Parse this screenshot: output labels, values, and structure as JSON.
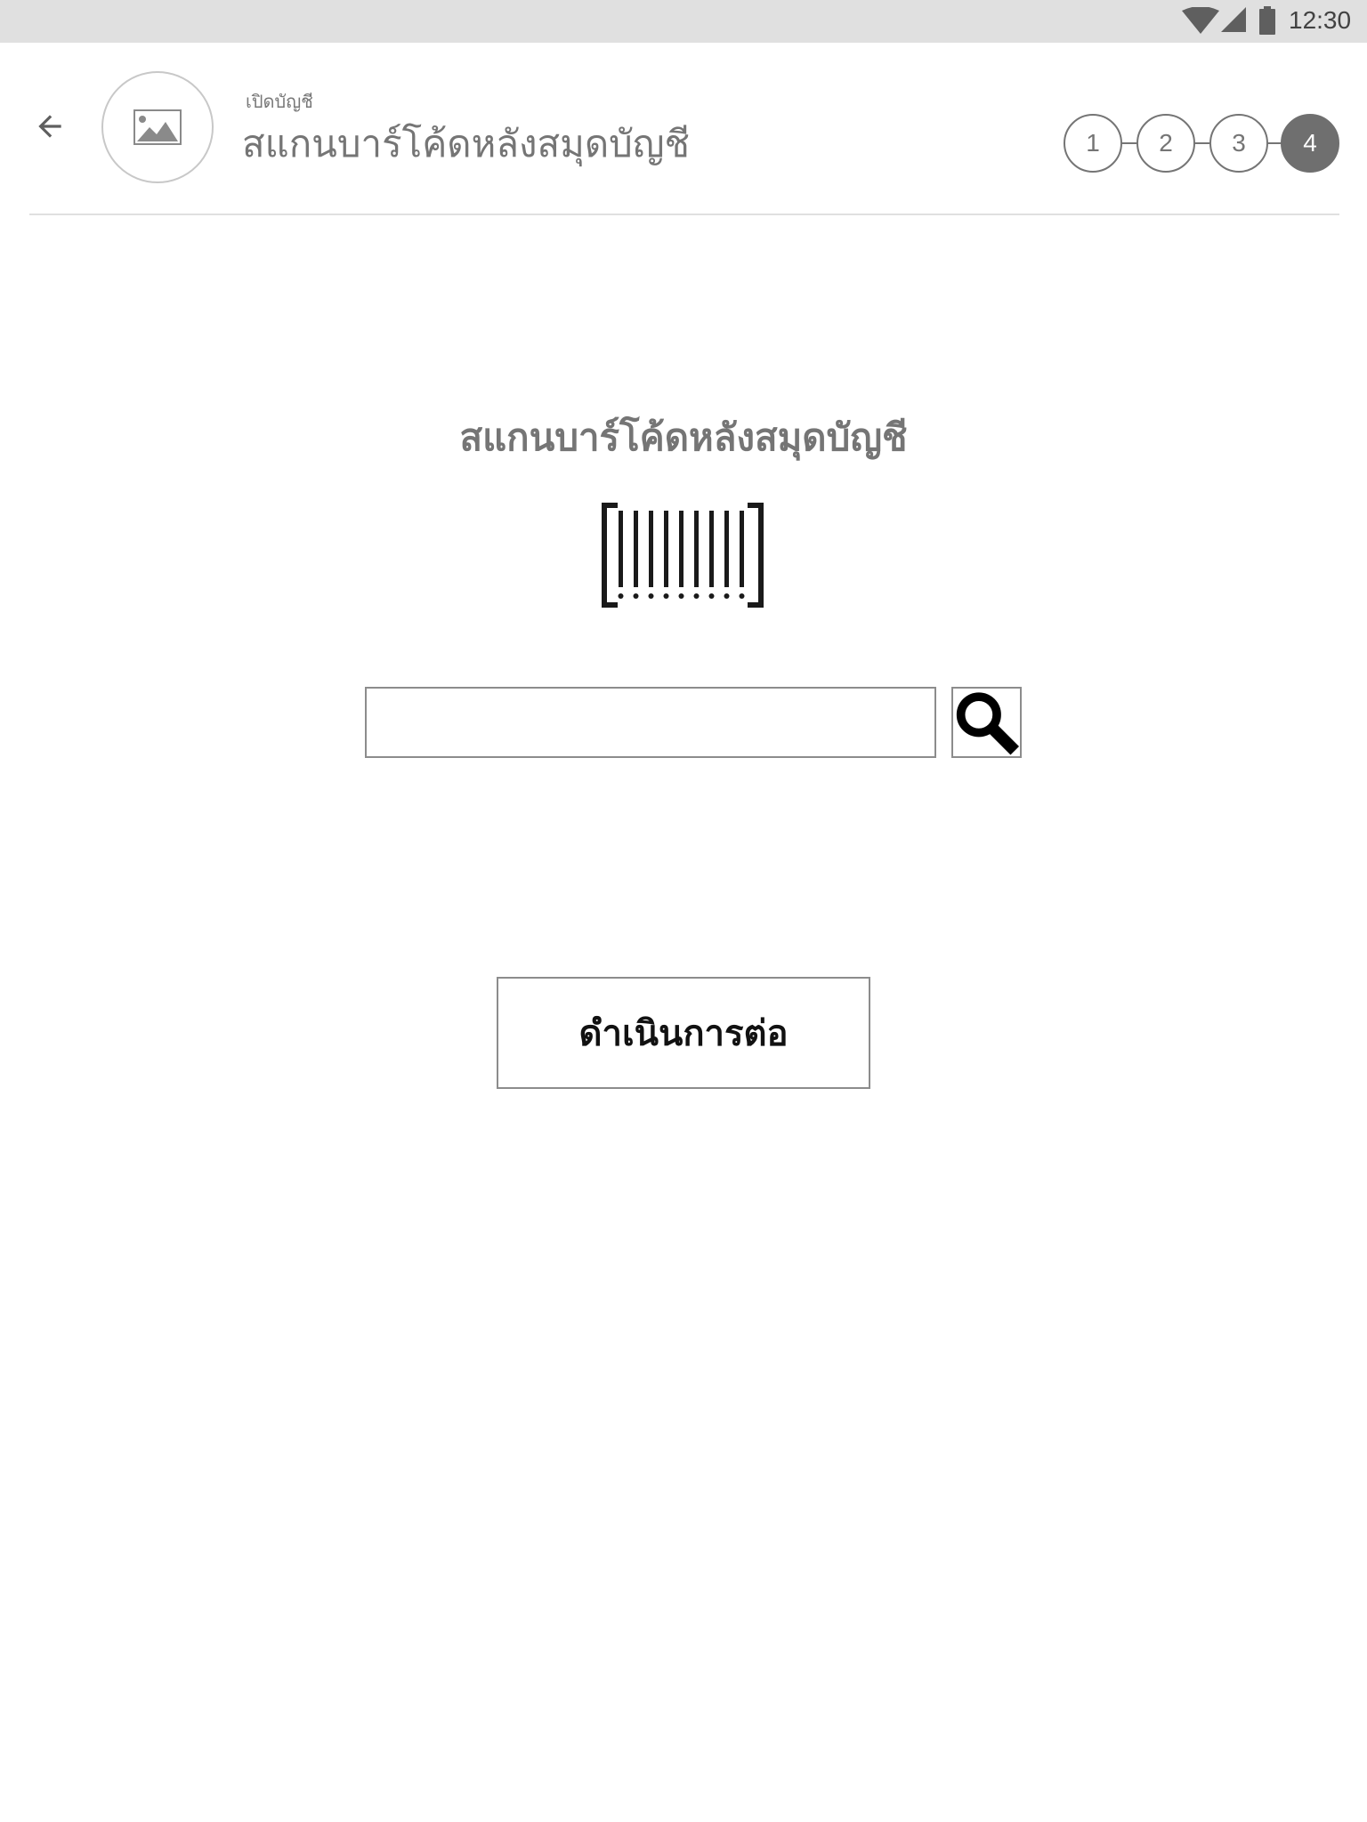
{
  "status_bar": {
    "time": "12:30",
    "icons": [
      "wifi-icon",
      "signal-icon",
      "battery-icon"
    ]
  },
  "header": {
    "back_icon": "arrow-left-icon",
    "avatar_icon": "image-placeholder-icon",
    "subtitle": "เปิดบัญชี",
    "title": "สแกนบาร์โค้ดหลังสมุดบัญชี"
  },
  "stepper": {
    "steps": [
      {
        "label": "1",
        "active": false
      },
      {
        "label": "2",
        "active": false
      },
      {
        "label": "3",
        "active": false
      },
      {
        "label": "4",
        "active": true
      }
    ]
  },
  "main": {
    "heading": "สแกนบาร์โค้ดหลังสมุดบัญชี",
    "barcode_icon": "barcode-scan-icon",
    "search": {
      "value": "",
      "placeholder": "",
      "button_icon": "search-icon"
    },
    "continue_label": "ดำเนินการต่อ"
  },
  "colors": {
    "status_bar_bg": "#e0e0e0",
    "text_gray": "#757575",
    "active_step": "#6f6f6f",
    "border": "#8c8c8c"
  }
}
